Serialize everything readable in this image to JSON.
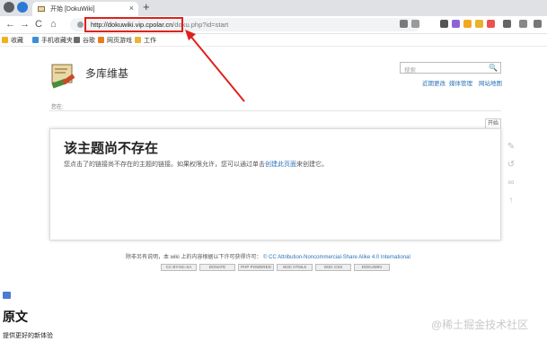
{
  "browser": {
    "tab_title": "开始 [DokuWiki]",
    "tab_close": "×",
    "new_tab": "+",
    "url_host": "http://dokuwiki.vip.cpolar.cn",
    "url_path": "/doku.php?id=start",
    "back": "←",
    "forward": "→",
    "reload": "C",
    "home": "⌂"
  },
  "bookmarks": [
    {
      "label": "收藏",
      "color": "#f2b01e"
    },
    {
      "label": "手机收藏夹",
      "color": "#3a8fd8"
    },
    {
      "label": "谷歌",
      "color": "#6a6a6a"
    },
    {
      "label": "网页游戏",
      "color": "#e87d1e"
    },
    {
      "label": "工作",
      "color": "#e8b43a"
    }
  ],
  "wiki": {
    "site_title": "多库维基",
    "search_placeholder": "搜索",
    "search_icon": "🔍",
    "links": [
      "近期更改",
      "媒体管理",
      "网站地图"
    ],
    "trace_label": "您在:",
    "page_tab": "开始",
    "heading": "该主题尚不存在",
    "message_pre": "您点击了的链接尚不存在的主题的链接。如果权限允许，您可以通过单击",
    "message_link": "创建此页面",
    "message_post": "来创建它。",
    "license_pre": "除非另有说明，本 wiki 上的内容根据以下许可获得许可：",
    "license_link": "CC Attribution-Noncommercial-Share Alike 4.0 International",
    "badges": [
      "CC BY-NC-SA",
      "DONATE",
      "PHP POWERED",
      "W3C HTML5",
      "W3C CSS",
      "DOKUWIKI"
    ]
  },
  "article": {
    "heading": "原文",
    "text": "提供更好的新体验"
  },
  "watermark": "@稀土掘金技术社区",
  "colors": {
    "highlight": "#e0211b",
    "link": "#2b73b7"
  }
}
